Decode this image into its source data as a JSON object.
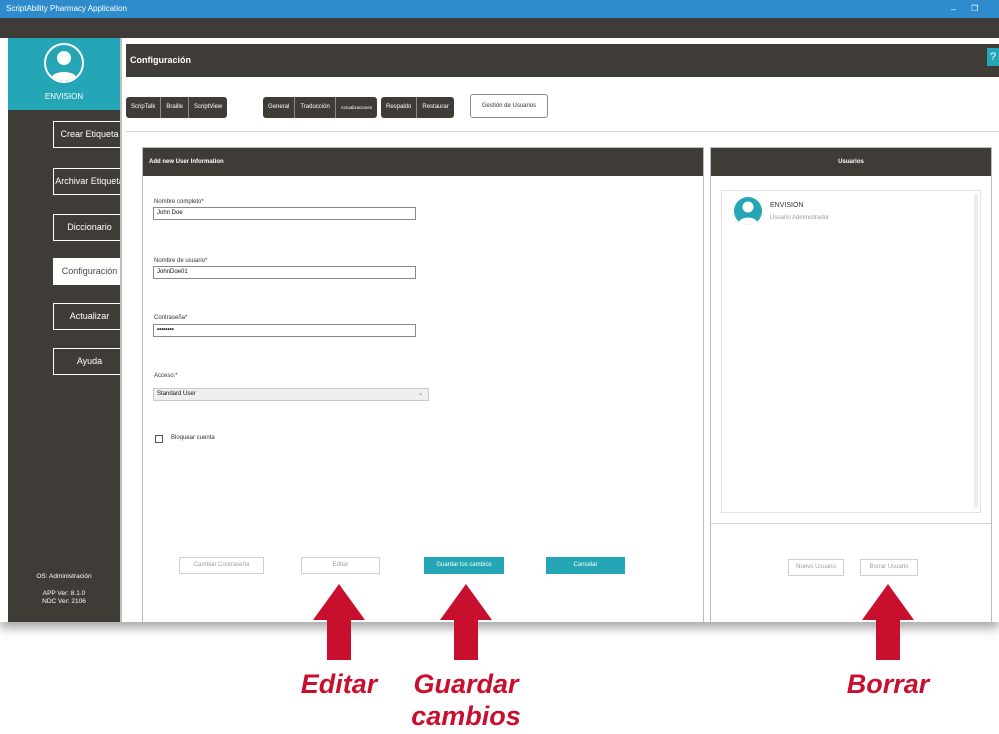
{
  "window": {
    "title": "ScriptAbility Pharmacy Application",
    "minimize_glyph": "–",
    "restore_glyph": "❐"
  },
  "sidebar": {
    "user_name": "ENVISION",
    "avatar_icon": "user-avatar-icon",
    "items": [
      {
        "label": "Crear Etiqueta",
        "active": false
      },
      {
        "label": "Archivar Etiqueta",
        "active": false
      },
      {
        "label": "Diccionario",
        "active": false
      },
      {
        "label": "Configuración",
        "active": true
      },
      {
        "label": "Actualizar",
        "active": false
      },
      {
        "label": "Ayuda",
        "active": false
      }
    ],
    "footer": {
      "os": "OS: Administración",
      "app_version": "APP Ver: 8.1.0",
      "ndc_version": "NDC Ver: 2106"
    }
  },
  "header": {
    "title": "Configuración",
    "help_label": "?"
  },
  "tabs": {
    "group1": [
      "ScripTalk",
      "Braille",
      "ScriptView"
    ],
    "group2": [
      "General",
      "Traducción",
      "Actualizaciones"
    ],
    "group3": [
      "Respaldo",
      "Restaurar"
    ],
    "user_management": "Gestión de Usuarios"
  },
  "form": {
    "title": "Add new User Information",
    "full_name_label": "Nombre completo*",
    "full_name_value": "John Doe",
    "username_label": "Nombre de usuario*",
    "username_value": "JohnDoe01",
    "password_label": "Contraseña*",
    "password_value": "••••••••",
    "access_label": "Acceso:*",
    "access_value": "Standard User",
    "lock_account_label": "Bloquear cuenta",
    "lock_account_checked": false,
    "buttons": {
      "change_password": "Cambiar Contraseña",
      "edit": "Editar",
      "save": "Guardar los cambios",
      "cancel": "Cancelar"
    }
  },
  "users_panel": {
    "title": "Usuarios",
    "users": [
      {
        "name": "ENVISION",
        "role": "Usuario Administrador"
      }
    ],
    "buttons": {
      "new_user": "Nuevo Usuario",
      "delete_user": "Borrar Usuario"
    }
  },
  "annotations": {
    "edit": "Editar",
    "save_line1": "Guardar",
    "save_line2": "cambios",
    "delete": "Borrar"
  },
  "colors": {
    "titlebar": "#2e8ccd",
    "dark": "#3f3c38",
    "accent": "#25a6b6",
    "annotation": "#c8102e"
  }
}
